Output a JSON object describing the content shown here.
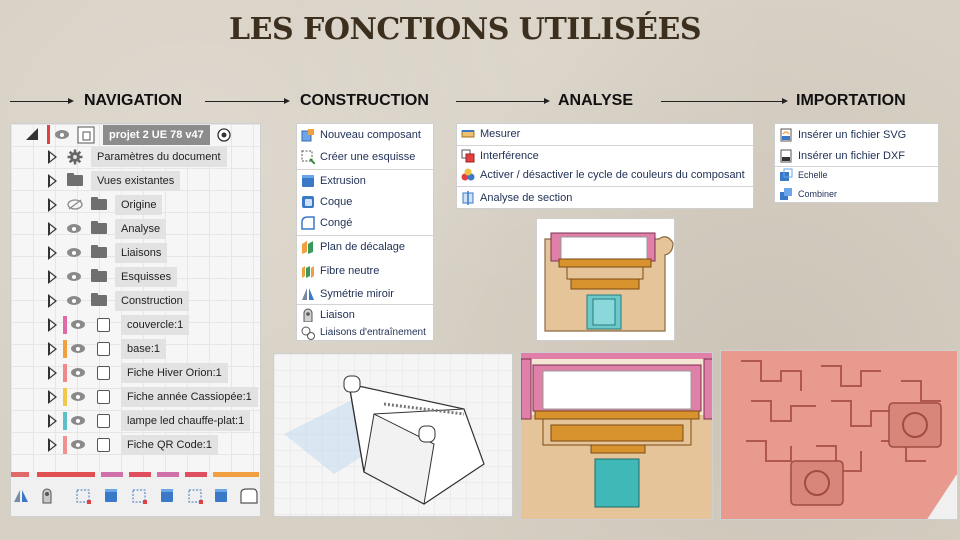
{
  "title": "LES FONCTIONS UTILISÉES",
  "sections": {
    "navigation": "NAVIGATION",
    "construction": "CONSTRUCTION",
    "analyse": "ANALYSE",
    "importation": "IMPORTATION"
  },
  "browser": {
    "root": "projet 2 UE 78 v47",
    "items": [
      {
        "label": "Paramètres du document",
        "icon": "gear-icon"
      },
      {
        "label": "Vues existantes",
        "icon": "folder-icon"
      },
      {
        "label": "Origine",
        "icon": "folder-icon",
        "hidden": true
      },
      {
        "label": "Analyse",
        "icon": "folder-icon"
      },
      {
        "label": "Liaisons",
        "icon": "folder-icon"
      },
      {
        "label": "Esquisses",
        "icon": "folder-icon"
      },
      {
        "label": "Construction",
        "icon": "folder-icon"
      },
      {
        "label": "couvercle:1",
        "icon": "component-icon",
        "color": "#e06aa8"
      },
      {
        "label": "base:1",
        "icon": "component-icon",
        "color": "#f0a040"
      },
      {
        "label": "Fiche Hiver Orion:1",
        "icon": "component-icon",
        "color": "#f08a8a"
      },
      {
        "label": "Fiche année Cassiopée:1",
        "icon": "component-icon",
        "color": "#f3c84a"
      },
      {
        "label": "lampe led chauffe-plat:1",
        "icon": "component-icon",
        "color": "#5bc0c8"
      },
      {
        "label": "Fiche QR Code:1",
        "icon": "component-icon",
        "color": "#f09090"
      }
    ]
  },
  "construction_menu": [
    {
      "label": "Nouveau composant",
      "icon": "new-component-icon"
    },
    {
      "label": "Créer une esquisse",
      "icon": "sketch-icon"
    },
    {
      "label": "Extrusion",
      "icon": "extrude-icon"
    },
    {
      "label": "Coque",
      "icon": "shell-icon"
    },
    {
      "label": "Congé",
      "icon": "fillet-icon"
    },
    {
      "label": "Plan de décalage",
      "icon": "offset-plane-icon"
    },
    {
      "label": "Fibre neutre",
      "icon": "midplane-icon"
    },
    {
      "label": "Symétrie miroir",
      "icon": "mirror-icon"
    },
    {
      "label": "Liaison",
      "icon": "joint-icon"
    },
    {
      "label": "Liaisons d'entraînement",
      "icon": "motion-link-icon"
    }
  ],
  "analyse_menu": [
    {
      "label": "Mesurer",
      "icon": "measure-icon"
    },
    {
      "label": "Interférence",
      "icon": "interference-icon"
    },
    {
      "label": "Activer / désactiver le cycle de couleurs du composant",
      "icon": "color-cycle-icon"
    },
    {
      "label": "Analyse de section",
      "icon": "section-analysis-icon"
    }
  ],
  "import_menu": [
    {
      "label": "Insérer un fichier SVG",
      "icon": "svg-file-icon"
    },
    {
      "label": "Insérer un fichier DXF",
      "icon": "dxf-file-icon"
    },
    {
      "label": "Echelle",
      "icon": "scale-icon"
    },
    {
      "label": "Combiner",
      "icon": "combine-icon"
    }
  ],
  "colors": {
    "title": "#3c2f1d",
    "menu_text": "#1f2f55",
    "pink": "#d88aa8",
    "orange": "#e3a55a",
    "tan": "#e5c49a",
    "teal": "#4fb8b8",
    "salmon": "#e89a8e"
  }
}
